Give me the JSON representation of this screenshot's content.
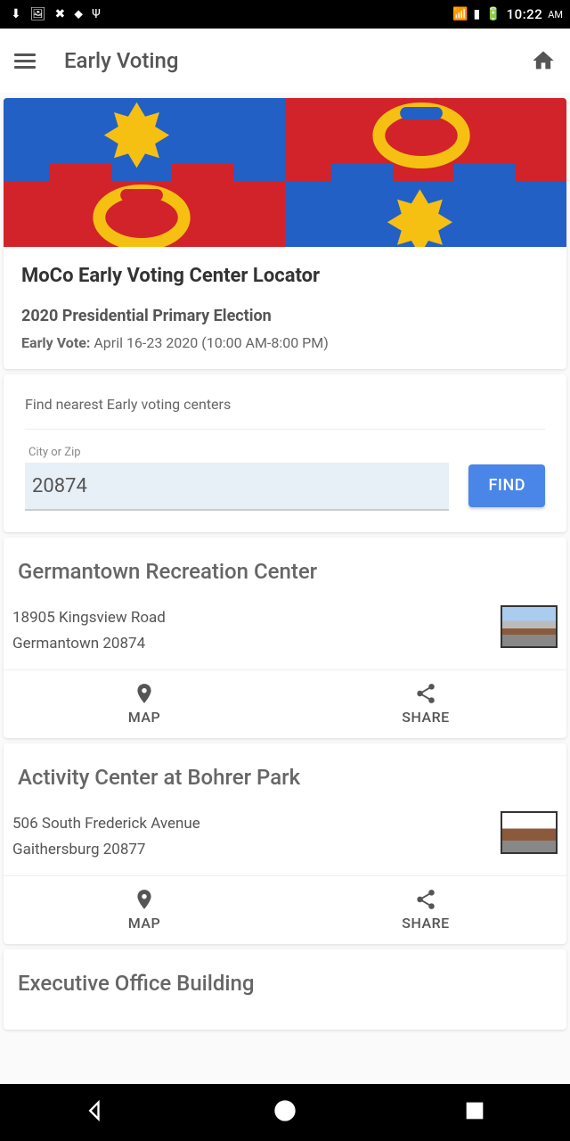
{
  "status": {
    "time": "10:22",
    "ampm": "AM"
  },
  "appbar": {
    "title": "Early Voting"
  },
  "header": {
    "title": "MoCo Early Voting Center Locator",
    "subtitle": "2020 Presidential Primary Election",
    "detail_label": "Early Vote:",
    "detail_value": "April 16-23 2020 (10:00 AM-8:00 PM)"
  },
  "search": {
    "prompt": "Find nearest Early voting centers",
    "input_label": "City or Zip",
    "input_value": "20874",
    "button": "FIND"
  },
  "actions": {
    "map": "MAP",
    "share": "SHARE"
  },
  "results": [
    {
      "name": "Germantown Recreation Center",
      "address1": "18905 Kingsview Road",
      "address2": "Germantown 20874"
    },
    {
      "name": "Activity Center at Bohrer Park",
      "address1": "506 South Frederick Avenue",
      "address2": "Gaithersburg 20877"
    },
    {
      "name": "Executive Office Building",
      "address1": "",
      "address2": ""
    }
  ]
}
